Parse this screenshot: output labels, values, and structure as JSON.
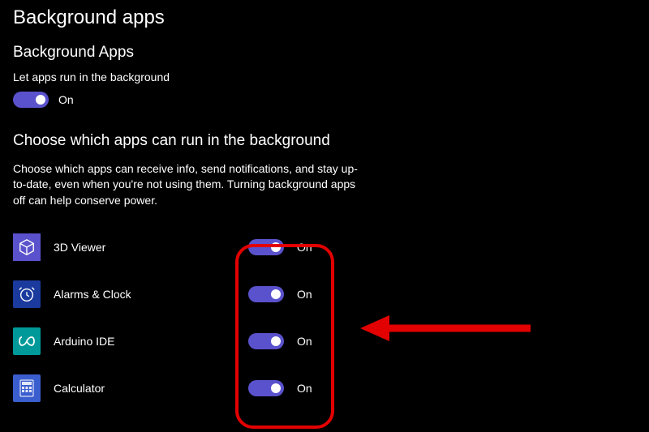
{
  "page": {
    "title": "Background apps"
  },
  "master": {
    "heading": "Background Apps",
    "subtext": "Let apps run in the background",
    "state_label": "On"
  },
  "choose": {
    "heading": "Choose which apps can run in the background",
    "description": "Choose which apps can receive info, send notifications, and stay up-to-date, even when you're not using them. Turning background apps off can help conserve power."
  },
  "apps": [
    {
      "name": "3D Viewer",
      "state": "On",
      "icon": "3dviewer"
    },
    {
      "name": "Alarms & Clock",
      "state": "On",
      "icon": "alarms"
    },
    {
      "name": "Arduino IDE",
      "state": "On",
      "icon": "arduino"
    },
    {
      "name": "Calculator",
      "state": "On",
      "icon": "calculator"
    }
  ],
  "colors": {
    "accent": "#5a52cc",
    "annotation": "#e20000"
  }
}
